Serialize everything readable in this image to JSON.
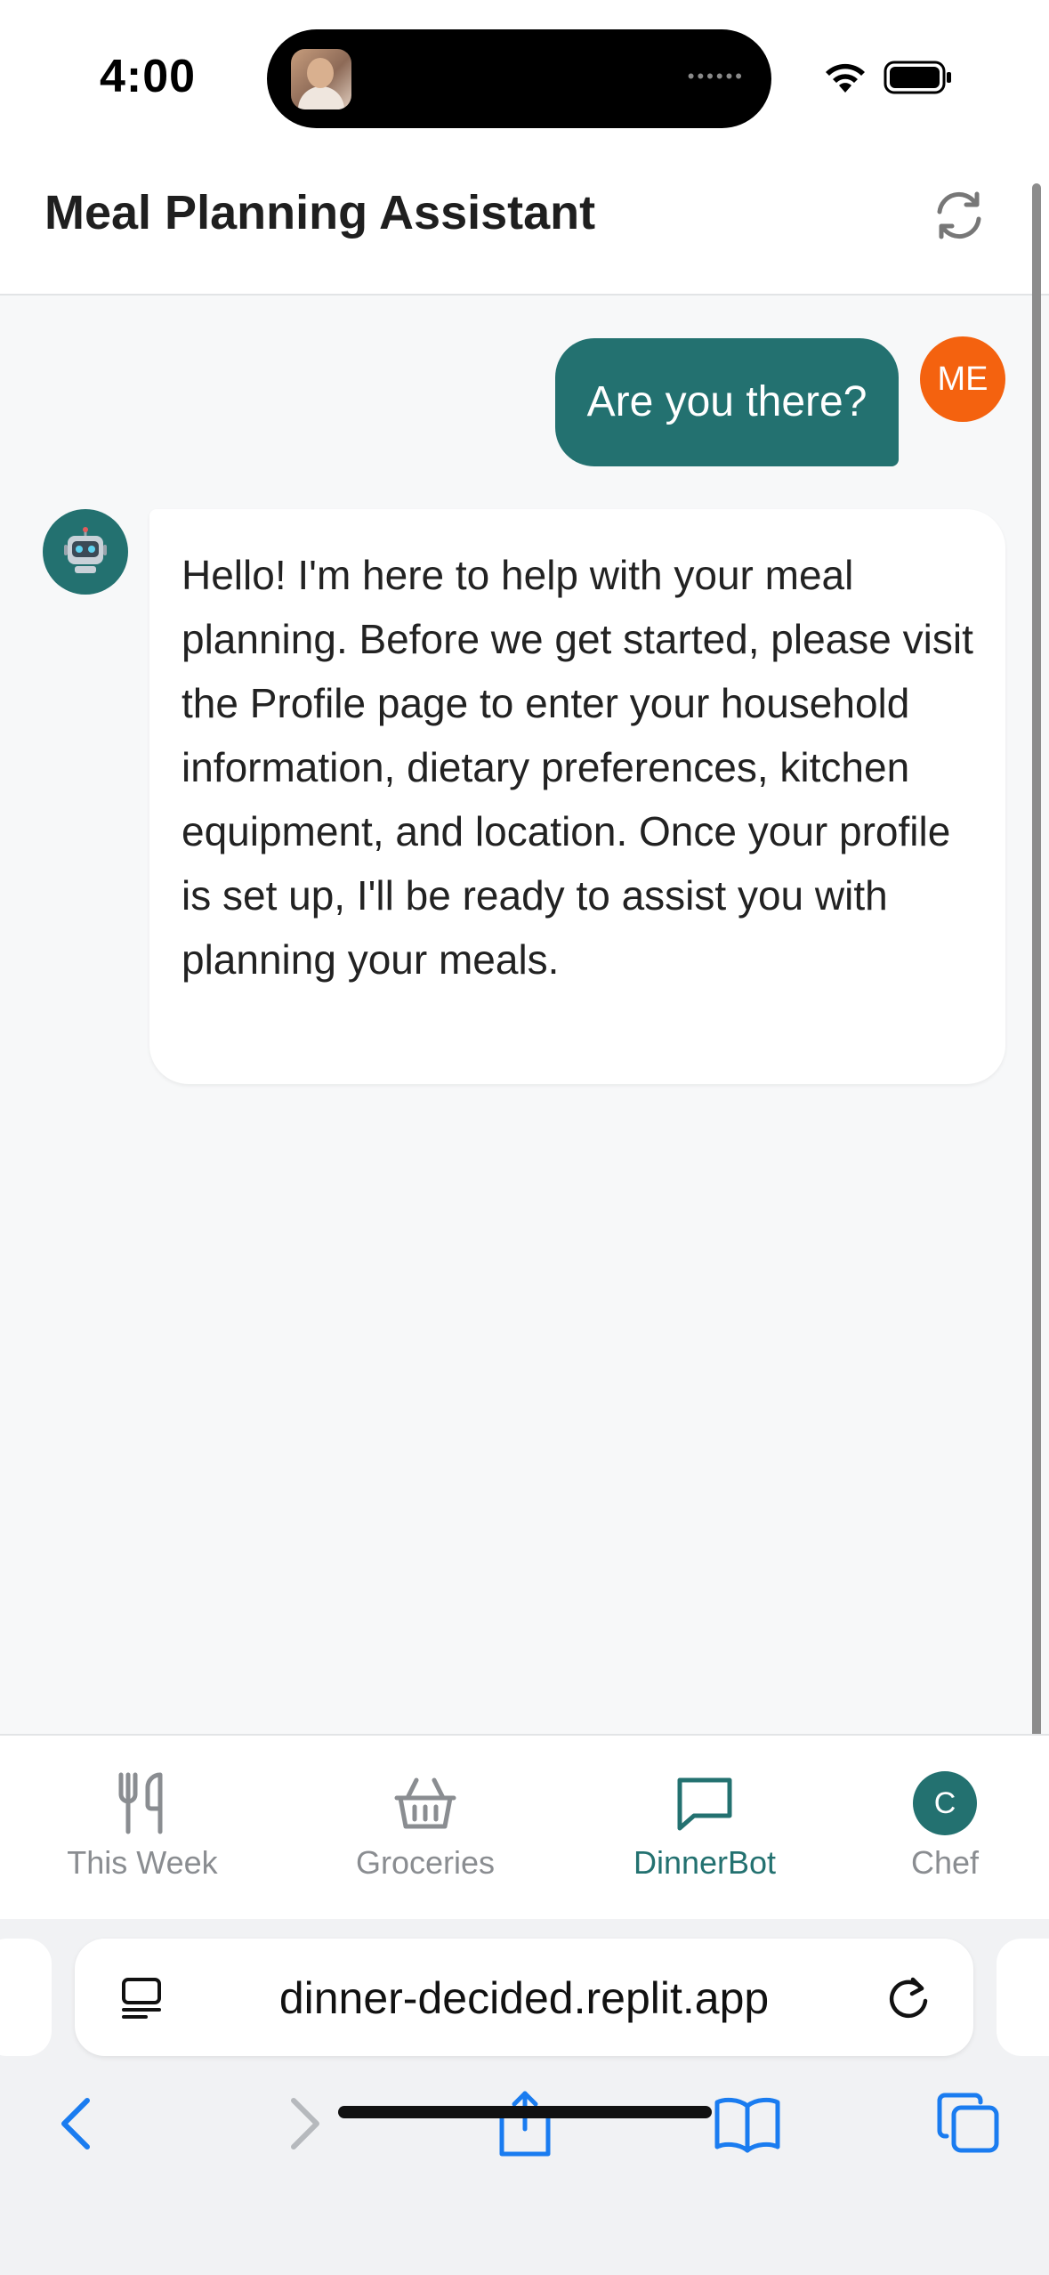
{
  "status_bar": {
    "time": "4:00"
  },
  "header": {
    "title": "Meal Planning Assistant"
  },
  "chat": {
    "messages": [
      {
        "role": "user",
        "avatar": "ME",
        "text": "Are you there?"
      },
      {
        "role": "bot",
        "avatar_icon": "robot-icon",
        "text": "Hello! I'm here to help with your meal planning. Before we get started, please visit the Profile page to enter your household information, dietary preferences, kitchen equipment, and location. Once your profile is set up, I'll be ready to assist you with planning your meals."
      }
    ]
  },
  "bottom_nav": {
    "items": [
      {
        "label": "This Week",
        "icon": "utensils-icon",
        "active": false
      },
      {
        "label": "Groceries",
        "icon": "basket-icon",
        "active": false
      },
      {
        "label": "DinnerBot",
        "icon": "chat-bubble-icon",
        "active": true
      },
      {
        "label": "Chef",
        "avatar": "C",
        "active": false
      }
    ]
  },
  "browser": {
    "url": "dinner-decided.replit.app"
  },
  "colors": {
    "accent": "#237170",
    "user_avatar": "#f4620f",
    "safari_blue": "#1a7cf0"
  }
}
